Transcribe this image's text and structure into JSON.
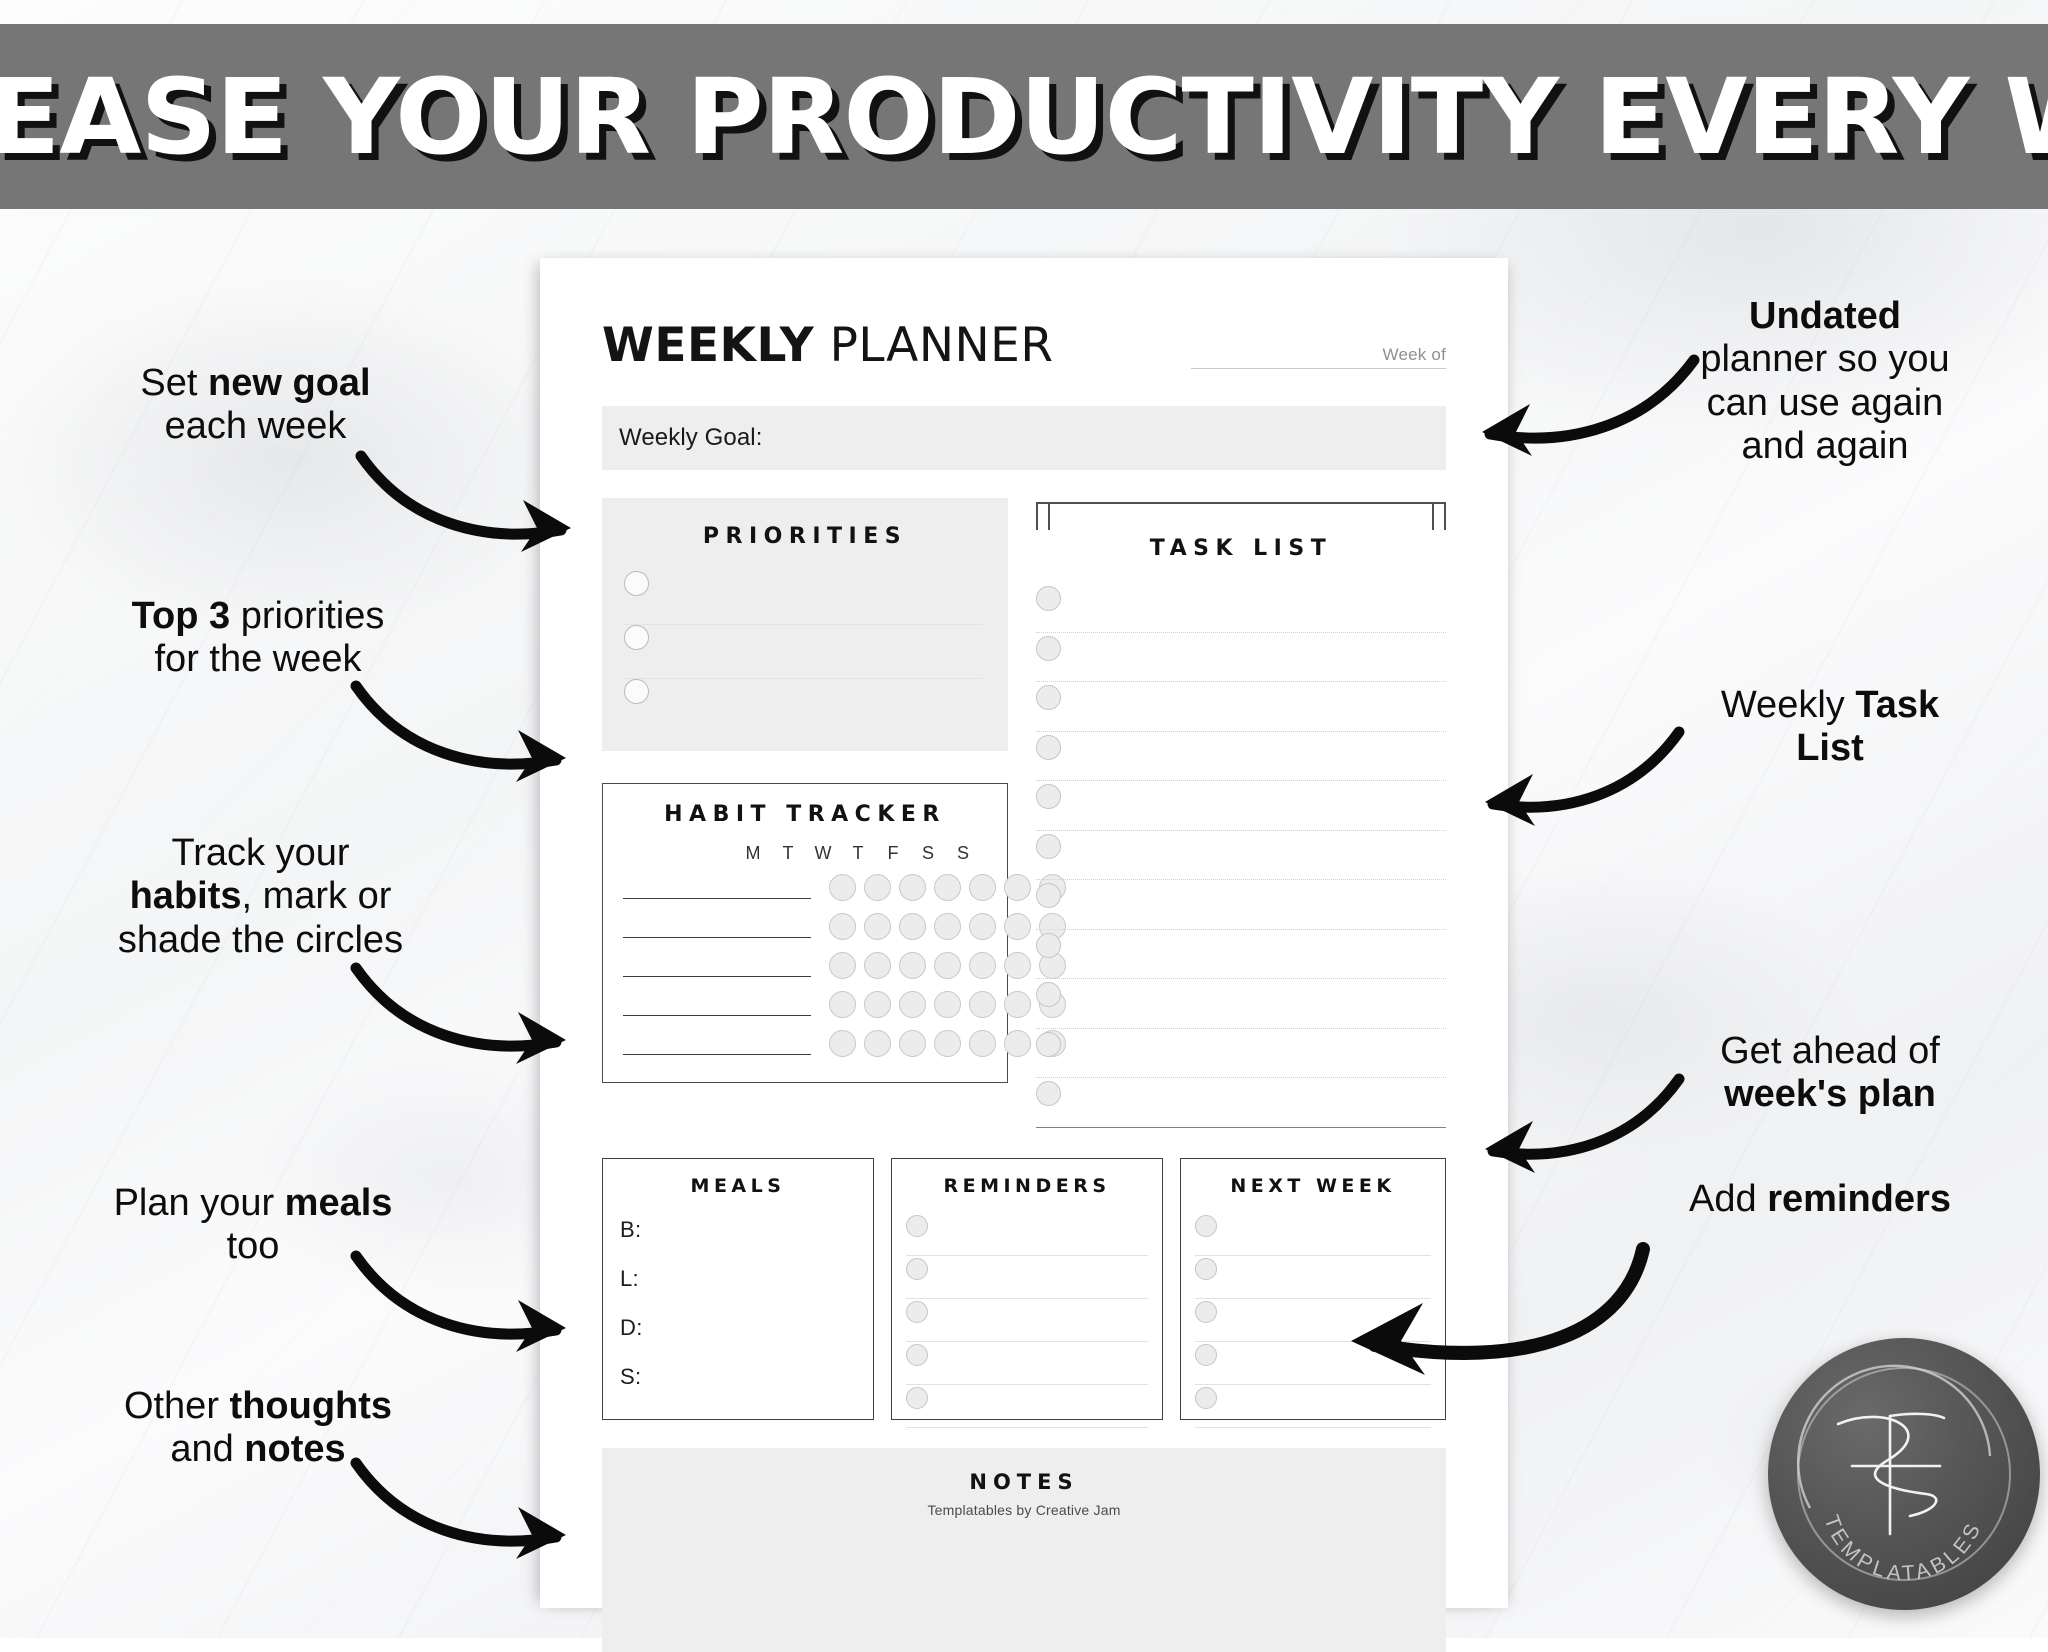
{
  "banner": {
    "headline": "INCREASE YOUR PRODUCTIVITY EVERY WEEK",
    "bg_color": "#767676",
    "text_color": "#ffffff"
  },
  "planner": {
    "title_bold": "WEEKLY",
    "title_light": " PLANNER",
    "week_of_label": "Week of",
    "weekly_goal_label": "Weekly Goal:",
    "priorities": {
      "heading": "PRIORITIES",
      "row_count": 3
    },
    "task_list": {
      "heading": "TASK LIST",
      "row_count": 11
    },
    "habit_tracker": {
      "heading": "HABIT TRACKER",
      "days": [
        "M",
        "T",
        "W",
        "T",
        "F",
        "S",
        "S"
      ],
      "habit_line_count": 5
    },
    "meals": {
      "heading": "MEALS",
      "rows": [
        "B:",
        "L:",
        "D:",
        "S:"
      ]
    },
    "reminders": {
      "heading": "REMINDERS",
      "row_count": 5
    },
    "next_week": {
      "heading": "NEXT WEEK",
      "row_count": 5
    },
    "notes": {
      "heading": "NOTES"
    },
    "footer": "Templatables by Creative Jam"
  },
  "annotations": {
    "left": [
      {
        "name": "set-new-goal",
        "line1_plain": "Set ",
        "line1_bold": "new goal",
        "line2": "each week"
      },
      {
        "name": "top-3-priorities",
        "line1_bold": "Top 3",
        "line1_plain": " priorities",
        "line2": "for the week"
      },
      {
        "name": "track-habits",
        "line1": "Track your",
        "line2_bold": "habits",
        "line2_plain": ", mark or",
        "line3": "shade the circles"
      },
      {
        "name": "plan-meals",
        "line1_plain": "Plan your ",
        "line1_bold": "meals",
        "line2": "too"
      },
      {
        "name": "thoughts-notes",
        "line1_plain": "Other ",
        "line1_bold": "thoughts",
        "line2_plain": "and ",
        "line2_bold": "notes"
      }
    ],
    "right": [
      {
        "name": "undated-planner",
        "line1_bold": "Undated",
        "line2": "planner so you",
        "line3": "can use again",
        "line4": "and again"
      },
      {
        "name": "weekly-task-list",
        "line1_plain": "Weekly ",
        "line1_bold": "Task",
        "line2_bold": "List"
      },
      {
        "name": "get-ahead",
        "line1": "Get ahead of",
        "line2_bold": "week's plan"
      },
      {
        "name": "add-reminders",
        "line1_plain": "Add ",
        "line1_bold": "reminders"
      }
    ]
  },
  "watermark": {
    "brand": "TEMPLATABLES",
    "monogram": "TP"
  }
}
